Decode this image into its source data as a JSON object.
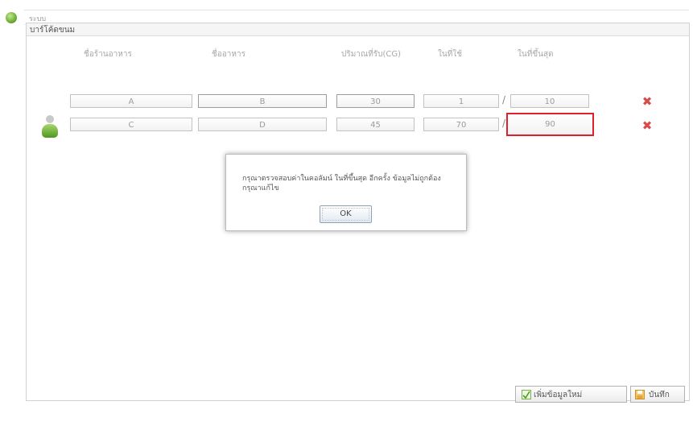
{
  "window": {
    "title": "ระบบ"
  },
  "panel": {
    "title": "บาร์โค้ดขนม"
  },
  "table": {
    "headers": [
      "ชื่อร้านอาหาร",
      "ชื่ออาหาร",
      "ปริมาณที่รับ(CG)",
      "ในที่ใช้",
      "ในที่ขึ้นสุด"
    ],
    "rows": [
      {
        "values": [
          "A",
          "B",
          "30",
          "1",
          "10"
        ],
        "error_col": null
      },
      {
        "values": [
          "C",
          "D",
          "45",
          "70",
          "90"
        ],
        "error_col": 4
      }
    ]
  },
  "dialog": {
    "message": "กรุณาตรวจสอบค่าในคอลัมน์ ในที่ขึ้นสุด อีกครั้ง ข้อมูลไม่ถูกต้อง กรุณาแก้ไข",
    "ok_label": "OK"
  },
  "footer": {
    "add_label": "เพิ่มข้อมูลใหม่",
    "save_label": "บันทึก"
  },
  "colors": {
    "error": "#e0202a",
    "delete": "#d94a4a",
    "accent": "#5fa32a"
  },
  "icons": {
    "app": "leaf-globe-icon",
    "row": "user-icon",
    "delete": "close-icon",
    "add": "add-icon",
    "save": "save-icon"
  }
}
